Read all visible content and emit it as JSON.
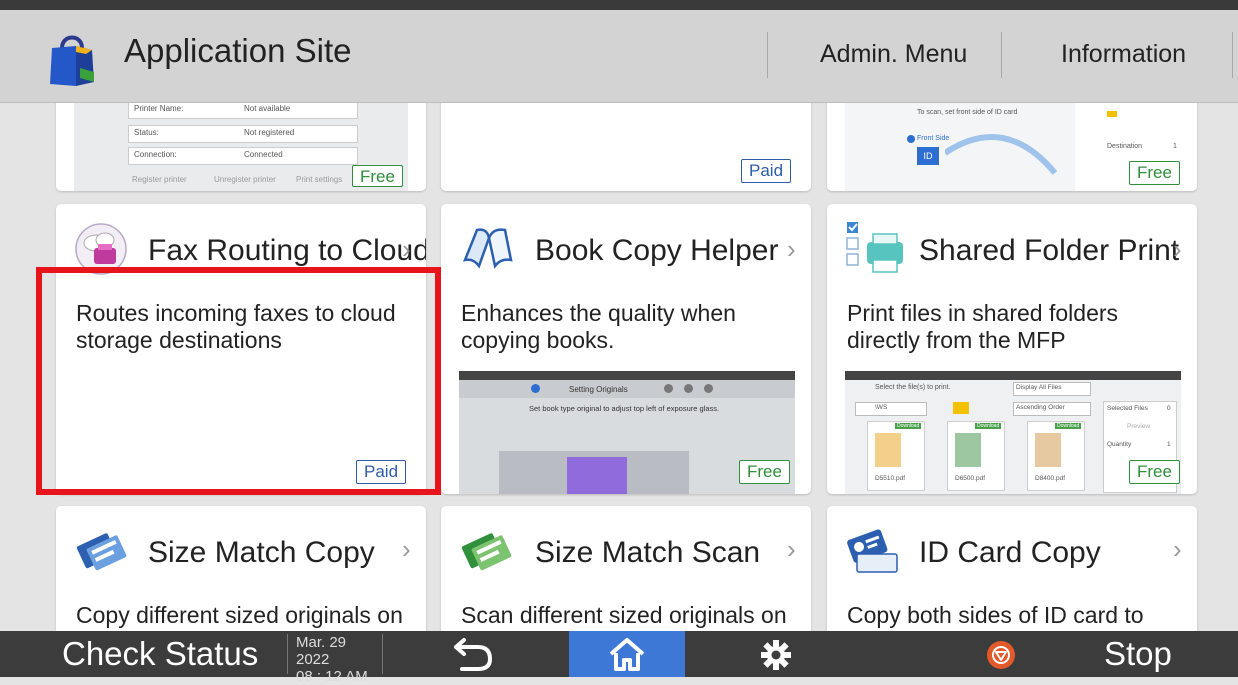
{
  "header": {
    "title": "Application Site",
    "menu": [
      "Admin. Menu",
      "Information"
    ]
  },
  "top_row": {
    "left_preview": {
      "rows": [
        {
          "label": "Printer Name:",
          "value": "Not available"
        },
        {
          "label": "Status:",
          "value": "Not registered"
        },
        {
          "label": "Connection:",
          "value": "Connected"
        }
      ],
      "tabs": [
        "Register printer",
        "Unregister printer",
        "Print settings"
      ],
      "badge": "Free"
    },
    "middle_badge": "Paid",
    "right_preview": {
      "caption": "To scan, set front side of ID card",
      "front_side": "Front Side",
      "id_label": "ID",
      "destination": "Destination",
      "destination_count": "1",
      "badge": "Free"
    }
  },
  "apps": [
    {
      "title": "Fax Routing to Cloud",
      "desc": "Routes incoming faxes to cloud storage destinations",
      "badge": "Paid",
      "icon": "fax-cloud-icon"
    },
    {
      "title": "Book Copy Helper",
      "desc": "Enhances the quality when copying books.",
      "badge": "Free",
      "icon": "open-book-icon",
      "preview": {
        "title": "Setting Originals",
        "text": "Set book type original to adjust top left of exposure glass."
      }
    },
    {
      "title": "Shared Folder Print",
      "desc": "Print files in shared folders directly from the MFP",
      "badge": "Free",
      "icon": "printer-folder-icon",
      "preview": {
        "prompt": "Select the file(s) to print.",
        "filter": "Display All Files",
        "folder": "\\WS",
        "sort": "Ascending Order",
        "selected_files_label": "Selected Files",
        "selected_files_count": "0",
        "preview_label": "Preview",
        "quantity_label": "Quantity",
        "quantity_value": "1",
        "download_label": "Download",
        "files": [
          "D5510.pdf",
          "D6500.pdf",
          "D8400.pdf"
        ]
      }
    },
    {
      "title": "Size Match Copy",
      "desc": "Copy different sized originals on",
      "icon": "size-match-copy-icon"
    },
    {
      "title": "Size Match Scan",
      "desc": "Scan different sized originals on",
      "icon": "size-match-scan-icon"
    },
    {
      "title": "ID Card Copy",
      "desc": "Copy both sides of ID card to one",
      "icon": "id-card-icon"
    }
  ],
  "taskbar": {
    "check_status": "Check Status",
    "date": "Mar. 29 2022",
    "time": "08 : 12 AM",
    "stop": "Stop"
  },
  "colors": {
    "header_bg": "#d3d3d3",
    "taskbar_bg": "#3c3c3c",
    "home_active": "#3d78d6",
    "paid": "#2e5da8",
    "free": "#2f8f3a",
    "highlight": "#e8141b",
    "stop": "#e25a2a"
  }
}
